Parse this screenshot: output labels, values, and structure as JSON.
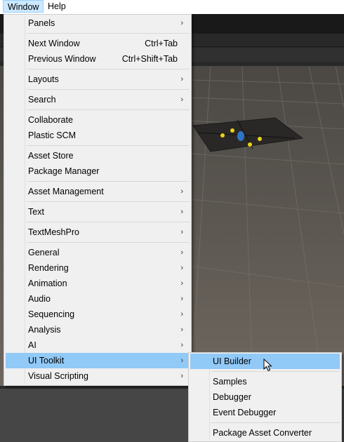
{
  "menubar": {
    "items": [
      "Window",
      "Help"
    ]
  },
  "window_menu": {
    "groups": [
      [
        {
          "label": "Panels",
          "arrow": true
        }
      ],
      [
        {
          "label": "Next Window",
          "shortcut": "Ctrl+Tab"
        },
        {
          "label": "Previous Window",
          "shortcut": "Ctrl+Shift+Tab"
        }
      ],
      [
        {
          "label": "Layouts",
          "arrow": true
        }
      ],
      [
        {
          "label": "Search",
          "arrow": true
        }
      ],
      [
        {
          "label": "Collaborate"
        },
        {
          "label": "Plastic SCM"
        }
      ],
      [
        {
          "label": "Asset Store"
        },
        {
          "label": "Package Manager"
        }
      ],
      [
        {
          "label": "Asset Management",
          "arrow": true
        }
      ],
      [
        {
          "label": "Text",
          "arrow": true
        }
      ],
      [
        {
          "label": "TextMeshPro",
          "arrow": true
        }
      ],
      [
        {
          "label": "General",
          "arrow": true
        },
        {
          "label": "Rendering",
          "arrow": true
        },
        {
          "label": "Animation",
          "arrow": true
        },
        {
          "label": "Audio",
          "arrow": true
        },
        {
          "label": "Sequencing",
          "arrow": true
        },
        {
          "label": "Analysis",
          "arrow": true
        },
        {
          "label": "AI",
          "arrow": true
        },
        {
          "label": "UI Toolkit",
          "arrow": true,
          "highlighted": true
        },
        {
          "label": "Visual Scripting",
          "arrow": true
        }
      ]
    ]
  },
  "submenu": {
    "groups": [
      [
        {
          "label": "UI Builder",
          "highlighted": true
        }
      ],
      [
        {
          "label": "Samples"
        },
        {
          "label": "Debugger"
        },
        {
          "label": "Event Debugger"
        }
      ],
      [
        {
          "label": "Package Asset Converter"
        }
      ]
    ]
  },
  "colors": {
    "highlight": "#91c9f7",
    "menu_bg": "#f0f0f0",
    "active_menubar": "#cce8ff"
  }
}
